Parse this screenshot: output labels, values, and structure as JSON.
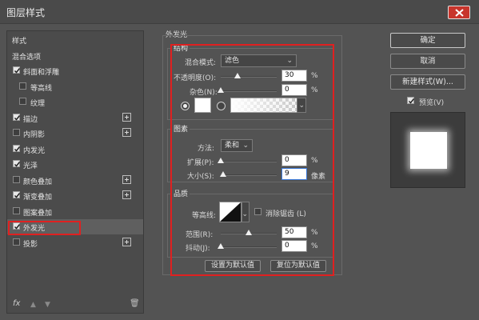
{
  "window": {
    "title": "图层样式"
  },
  "styles_list": {
    "items": [
      {
        "label": "样式",
        "checkbox": null,
        "plus": false
      },
      {
        "label": "混合选项",
        "checkbox": null,
        "plus": false
      },
      {
        "label": "斜面和浮雕",
        "checkbox": true,
        "plus": false
      },
      {
        "label": "等高线",
        "checkbox": false,
        "plus": false,
        "sub": true
      },
      {
        "label": "纹理",
        "checkbox": false,
        "plus": false,
        "sub": true
      },
      {
        "label": "描边",
        "checkbox": true,
        "plus": true
      },
      {
        "label": "内阴影",
        "checkbox": false,
        "plus": true
      },
      {
        "label": "内发光",
        "checkbox": true,
        "plus": false
      },
      {
        "label": "光泽",
        "checkbox": true,
        "plus": false
      },
      {
        "label": "颜色叠加",
        "checkbox": false,
        "plus": true
      },
      {
        "label": "渐变叠加",
        "checkbox": true,
        "plus": true
      },
      {
        "label": "图案叠加",
        "checkbox": false,
        "plus": false
      },
      {
        "label": "外发光",
        "checkbox": true,
        "plus": false,
        "selected": true
      },
      {
        "label": "投影",
        "checkbox": false,
        "plus": true
      }
    ],
    "footer_fx": "fx"
  },
  "panel": {
    "title": "外发光",
    "structure": {
      "title": "结构",
      "blend_mode_label": "混合模式:",
      "blend_mode_value": "滤色",
      "opacity_label": "不透明度(O):",
      "opacity_value": "30",
      "opacity_unit": "%",
      "opacity_level": 0.3,
      "noise_label": "杂色(N):",
      "noise_value": "0",
      "noise_unit": "%",
      "noise_level": 0.0
    },
    "elements": {
      "title": "图素",
      "method_label": "方法:",
      "method_value": "柔和",
      "spread_label": "扩展(P):",
      "spread_value": "0",
      "spread_unit": "%",
      "spread_level": 0.0,
      "size_label": "大小(S):",
      "size_value": "9",
      "size_unit": "像素",
      "size_level": 0.04
    },
    "quality": {
      "title": "品质",
      "contour_label": "等高线:",
      "antialias_label": "消除锯齿 (L)",
      "range_label": "范围(R):",
      "range_value": "50",
      "range_unit": "%",
      "range_level": 0.5,
      "jitter_label": "抖动(J):",
      "jitter_value": "0",
      "jitter_unit": "%",
      "jitter_level": 0.0
    },
    "make_default": "设置为默认值",
    "reset_default": "复位为默认值"
  },
  "right": {
    "ok": "确定",
    "cancel": "取消",
    "new_style": "新建样式(W)...",
    "preview_label": "预览(V)"
  },
  "colors": {
    "highlight_box": "#e02020",
    "background": "#535353"
  }
}
